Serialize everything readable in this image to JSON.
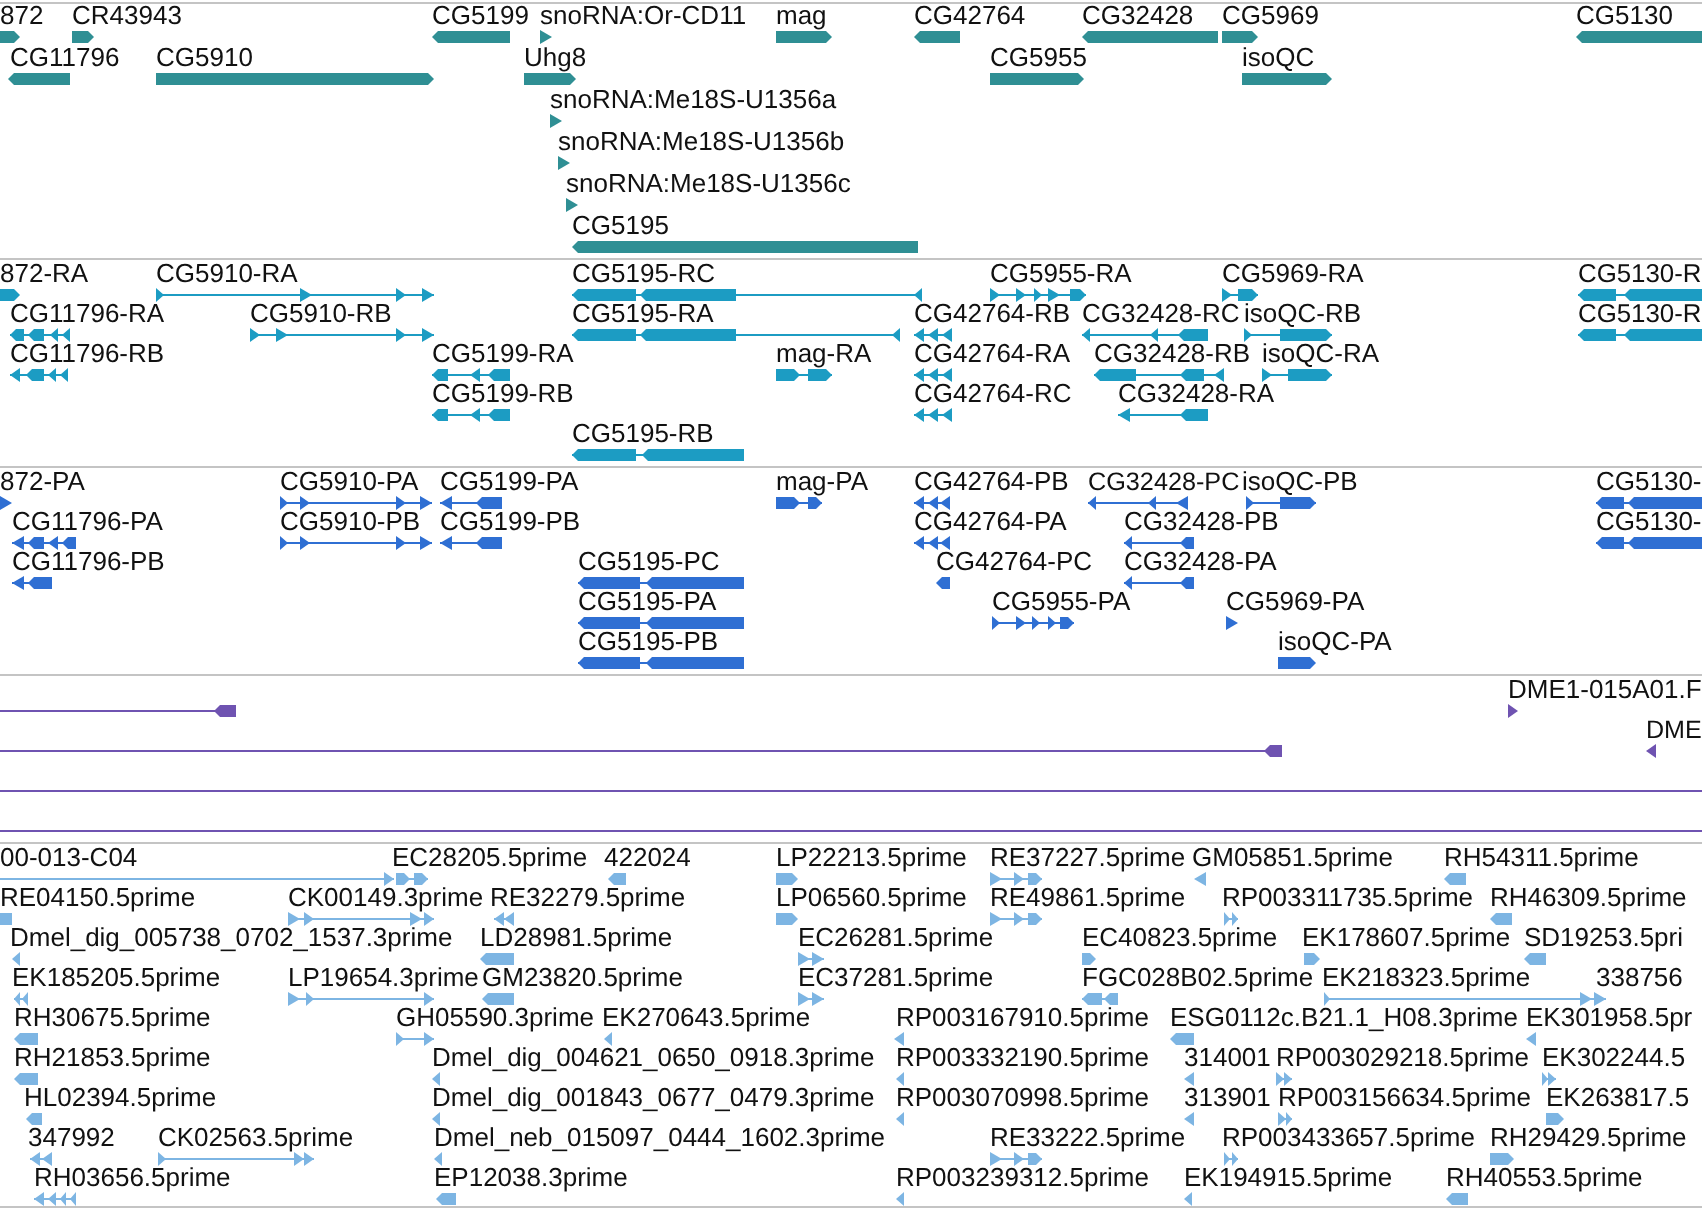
{
  "tracks": [
    {
      "color": "#2f8f94",
      "rows": [
        {
          "features": [
            {
              "label": "872",
              "reverse": false
            },
            {
              "label": "CR43943",
              "reverse": false
            },
            {
              "label": "CG5199",
              "reverse": true
            },
            {
              "label": "snoRNA:Or-CD11",
              "reverse": false
            },
            {
              "label": "mag",
              "reverse": false
            },
            {
              "label": "CG42764",
              "reverse": true
            },
            {
              "label": "CG32428",
              "reverse": true
            },
            {
              "label": "CG5969",
              "reverse": false
            },
            {
              "label": "CG5130",
              "reverse": true
            }
          ]
        },
        {
          "features": [
            {
              "label": "CG11796",
              "reverse": true
            },
            {
              "label": "CG5910",
              "reverse": false
            },
            {
              "label": "Uhg8",
              "reverse": false
            },
            {
              "label": "CG5955",
              "reverse": false
            },
            {
              "label": "isoQC",
              "reverse": false
            }
          ]
        },
        {
          "features": [
            {
              "label": "snoRNA:Me18S-U1356a",
              "reverse": false
            }
          ]
        },
        {
          "features": [
            {
              "label": "snoRNA:Me18S-U1356b",
              "reverse": false
            }
          ]
        },
        {
          "features": [
            {
              "label": "snoRNA:Me18S-U1356c",
              "reverse": false
            }
          ]
        },
        {
          "features": [
            {
              "label": "CG5195",
              "reverse": true
            }
          ]
        }
      ]
    },
    {
      "color": "#1c9cc3",
      "rows": [
        {
          "features": [
            {
              "label": "872-RA",
              "reverse": false
            },
            {
              "label": "CG5910-RA",
              "reverse": false
            },
            {
              "label": "CG5195-RC",
              "reverse": true
            },
            {
              "label": "CG5955-RA",
              "reverse": false
            },
            {
              "label": "CG5969-RA",
              "reverse": false
            },
            {
              "label": "CG5130-R",
              "reverse": true
            }
          ]
        },
        {
          "features": [
            {
              "label": "CG11796-RA",
              "reverse": true
            },
            {
              "label": "CG5910-RB",
              "reverse": false
            },
            {
              "label": "CG5195-RA",
              "reverse": true
            },
            {
              "label": "CG42764-RB",
              "reverse": true
            },
            {
              "label": "CG32428-RC",
              "reverse": true
            },
            {
              "label": "isoQC-RB",
              "reverse": false
            },
            {
              "label": "CG5130-R",
              "reverse": true
            }
          ]
        },
        {
          "features": [
            {
              "label": "CG11796-RB",
              "reverse": true
            },
            {
              "label": "CG5199-RA",
              "reverse": true
            },
            {
              "label": "mag-RA",
              "reverse": false
            },
            {
              "label": "CG42764-RA",
              "reverse": true
            },
            {
              "label": "CG32428-RB",
              "reverse": true
            },
            {
              "label": "isoQC-RA",
              "reverse": false
            }
          ]
        },
        {
          "features": [
            {
              "label": "CG5199-RB",
              "reverse": true
            },
            {
              "label": "CG42764-RC",
              "reverse": true
            },
            {
              "label": "CG32428-RA",
              "reverse": true
            }
          ]
        },
        {
          "features": [
            {
              "label": "CG5195-RB",
              "reverse": true
            }
          ]
        }
      ]
    },
    {
      "color": "#2f6fd3",
      "rows": [
        {
          "features": [
            {
              "label": "872-PA",
              "reverse": false
            },
            {
              "label": "CG5910-PA",
              "reverse": false
            },
            {
              "label": "CG5199-PA",
              "reverse": true
            },
            {
              "label": "mag-PA",
              "reverse": false
            },
            {
              "label": "CG42764-PB",
              "reverse": true
            },
            {
              "label": "CG32428-PC",
              "reverse": true
            },
            {
              "label": "isoQC-PB",
              "reverse": false
            },
            {
              "label": "CG5130-",
              "reverse": true
            }
          ]
        },
        {
          "features": [
            {
              "label": "CG11796-PA",
              "reverse": true
            },
            {
              "label": "CG5910-PB",
              "reverse": false
            },
            {
              "label": "CG5199-PB",
              "reverse": true
            },
            {
              "label": "CG42764-PA",
              "reverse": true
            },
            {
              "label": "CG32428-PB",
              "reverse": true
            },
            {
              "label": "CG5130-",
              "reverse": true
            }
          ]
        },
        {
          "features": [
            {
              "label": "CG11796-PB",
              "reverse": true
            },
            {
              "label": "CG5195-PC",
              "reverse": true
            },
            {
              "label": "CG42764-PC",
              "reverse": true
            },
            {
              "label": "CG32428-PA",
              "reverse": true
            }
          ]
        },
        {
          "features": [
            {
              "label": "CG5195-PA",
              "reverse": true
            },
            {
              "label": "CG5955-PA",
              "reverse": false
            },
            {
              "label": "CG5969-PA",
              "reverse": false
            }
          ]
        },
        {
          "features": [
            {
              "label": "CG5195-PB",
              "reverse": true
            },
            {
              "label": "isoQC-PA",
              "reverse": false
            }
          ]
        }
      ]
    },
    {
      "color": "#6f53b1",
      "rows": [
        {
          "features": [
            {
              "reverse": true
            },
            {
              "label": "DME1-015A01.F",
              "reverse": false
            }
          ]
        },
        {
          "features": [
            {
              "reverse": true
            },
            {
              "label": "DME",
              "reverse": true
            }
          ]
        },
        {
          "features": [
            {
              "kind": "line"
            }
          ]
        },
        {
          "features": [
            {
              "kind": "line"
            }
          ]
        }
      ]
    },
    {
      "color": "#7db5e3",
      "rows": [
        {
          "features": [
            {
              "label": "00-013-C04",
              "reverse": false
            },
            {
              "label": "EC28205.5prime",
              "reverse": false
            },
            {
              "label": "422024",
              "reverse": true
            },
            {
              "label": "LP22213.5prime",
              "reverse": false
            },
            {
              "label": "RE37227.5prime",
              "reverse": false
            },
            {
              "label": "GM05851.5prime",
              "reverse": true
            },
            {
              "label": "RH54311.5prime",
              "reverse": true
            }
          ]
        },
        {
          "features": [
            {
              "label": "RE04150.5prime"
            },
            {
              "label": "CK00149.3prime",
              "reverse": false
            },
            {
              "label": "RE32279.5prime",
              "reverse": true
            },
            {
              "label": "LP06560.5prime",
              "reverse": false
            },
            {
              "label": "RE49861.5prime",
              "reverse": false
            },
            {
              "label": "RP003311735.5prime",
              "reverse": false
            },
            {
              "label": "RH46309.5prime",
              "reverse": true
            }
          ]
        },
        {
          "features": [
            {
              "label": "Dmel_dig_005738_0702_1537.3prime",
              "reverse": true
            },
            {
              "label": "LD28981.5prime",
              "reverse": true
            },
            {
              "label": "EC26281.5prime",
              "reverse": false
            },
            {
              "label": "EC40823.5prime",
              "reverse": false
            },
            {
              "label": "EK178607.5prime",
              "reverse": false
            },
            {
              "label": "SD19253.5pri",
              "reverse": true
            }
          ]
        },
        {
          "features": [
            {
              "label": "EK185205.5prime",
              "reverse": true
            },
            {
              "label": "LP19654.3prime",
              "reverse": false
            },
            {
              "label": "GM23820.5prime",
              "reverse": true
            },
            {
              "label": "EC37281.5prime",
              "reverse": false
            },
            {
              "label": "FGC028B02.5prime",
              "reverse": true
            },
            {
              "label": "EK218323.5prime",
              "reverse": false
            },
            {
              "label": "338756"
            }
          ]
        },
        {
          "features": [
            {
              "label": "RH30675.5prime",
              "reverse": true
            },
            {
              "label": "GH05590.3prime",
              "reverse": false
            },
            {
              "label": "EK270643.5prime",
              "reverse": true
            },
            {
              "label": "RP003167910.5prime",
              "reverse": true
            },
            {
              "label": "ESG0112c.B21.1_H08.3prime",
              "reverse": true
            },
            {
              "label": "EK301958.5pr",
              "reverse": true
            }
          ]
        },
        {
          "features": [
            {
              "label": "RH21853.5prime",
              "reverse": true
            },
            {
              "label": "Dmel_dig_004621_0650_0918.3prime",
              "reverse": true
            },
            {
              "label": "RP003332190.5prime",
              "reverse": true
            },
            {
              "label": "314001",
              "reverse": true
            },
            {
              "label": "RP003029218.5prime",
              "reverse": false
            },
            {
              "label": "EK302244.5",
              "reverse": false
            }
          ]
        },
        {
          "features": [
            {
              "label": "HL02394.5prime",
              "reverse": true
            },
            {
              "label": "Dmel_dig_001843_0677_0479.3prime",
              "reverse": true
            },
            {
              "label": "RP003070998.5prime",
              "reverse": true
            },
            {
              "label": "313901",
              "reverse": true
            },
            {
              "label": "RP003156634.5prime",
              "reverse": false
            },
            {
              "label": "EK263817.5",
              "reverse": false
            }
          ]
        },
        {
          "features": [
            {
              "label": "347992",
              "reverse": true
            },
            {
              "label": "CK02563.5prime",
              "reverse": false
            },
            {
              "label": "Dmel_neb_015097_0444_1602.3prime",
              "reverse": true
            },
            {
              "label": "RE33222.5prime",
              "reverse": false
            },
            {
              "label": "RP003433657.5prime",
              "reverse": false
            },
            {
              "label": "RH29429.5prime",
              "reverse": false
            }
          ]
        },
        {
          "features": [
            {
              "label": "RH03656.5prime",
              "reverse": true
            },
            {
              "label": "EP12038.3prime",
              "reverse": true
            },
            {
              "label": "RP003239312.5prime",
              "reverse": true
            },
            {
              "label": "EK194915.5prime",
              "reverse": true
            },
            {
              "label": "RH40553.5prime",
              "reverse": true
            }
          ]
        }
      ]
    }
  ]
}
